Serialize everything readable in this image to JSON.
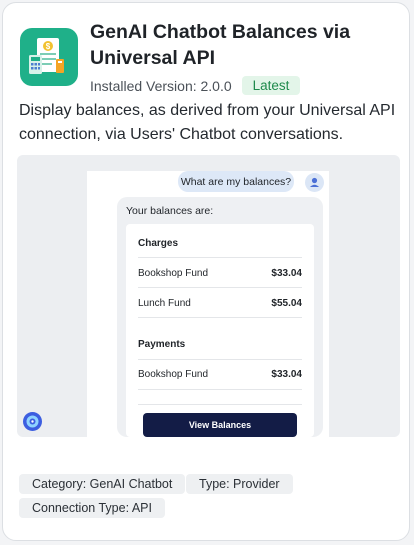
{
  "app": {
    "title": "GenAI Chatbot Balances via Universal API",
    "version_text": "Installed Version: 2.0.0",
    "badge": "Latest",
    "description": "Display balances, as derived from your Universal API connection, via Users' Chatbot conversations.",
    "icon": "finance-document-icon",
    "accent_color": "#1fb089"
  },
  "preview": {
    "user_message": "What are my balances?",
    "bot_intro": "Your balances are:",
    "sections": [
      {
        "title": "Charges",
        "rows": [
          {
            "name": "Bookshop Fund",
            "amount": "$33.04"
          },
          {
            "name": "Lunch Fund",
            "amount": "$55.04"
          }
        ]
      },
      {
        "title": "Payments",
        "rows": [
          {
            "name": "Bookshop Fund",
            "amount": "$33.04"
          }
        ]
      }
    ],
    "button_label": "View Balances",
    "button_color": "#131c46"
  },
  "tags": [
    {
      "label": "Category: GenAI Chatbot"
    },
    {
      "label": "Type: Provider"
    },
    {
      "label": "Connection Type: API"
    }
  ]
}
